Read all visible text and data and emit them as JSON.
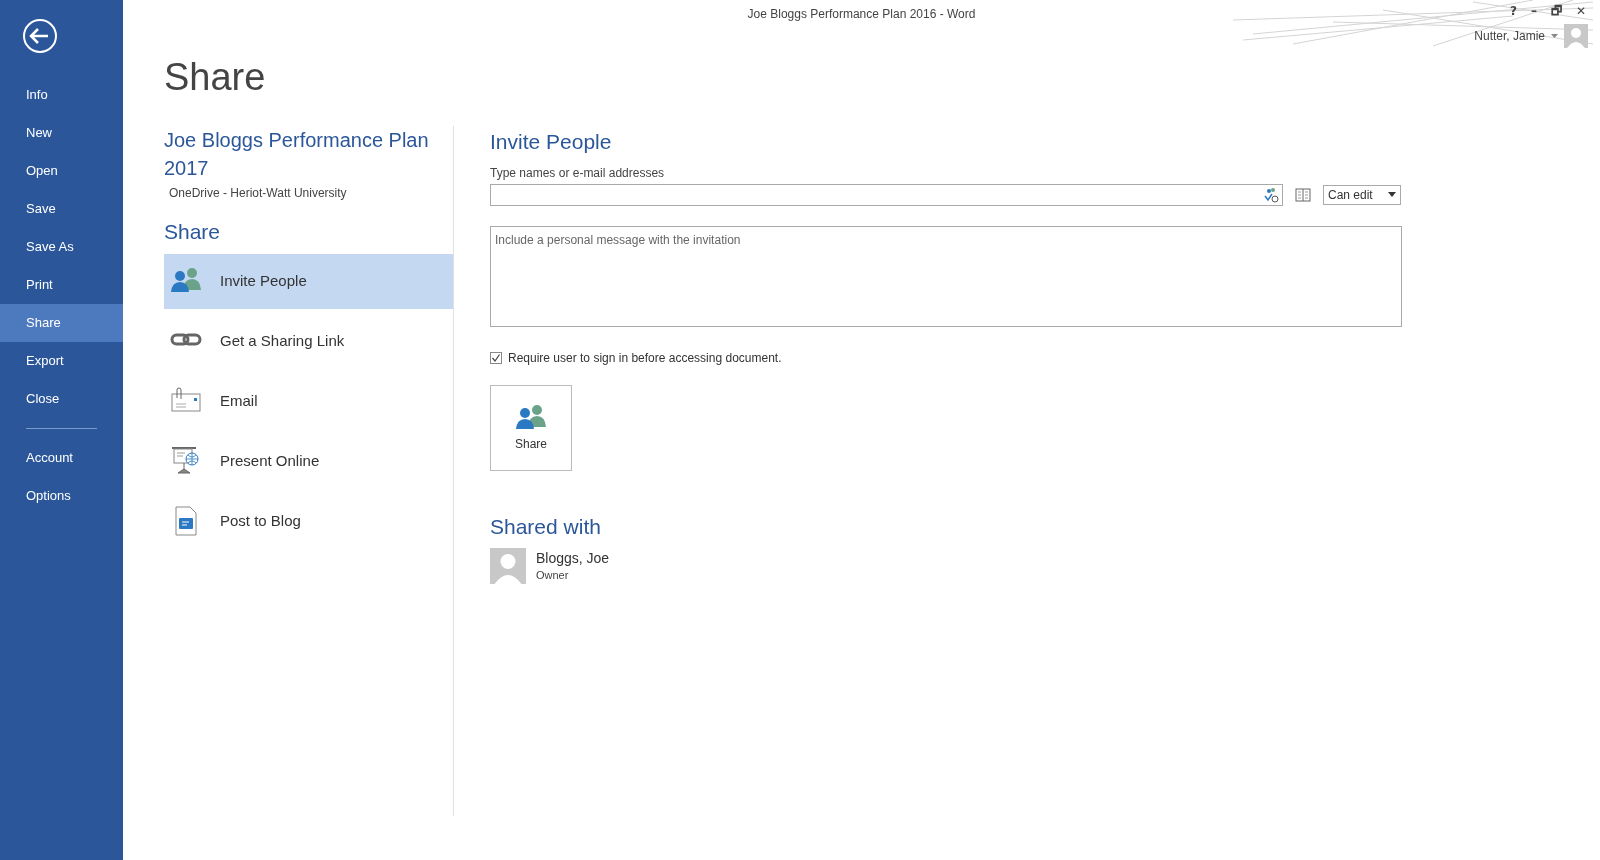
{
  "window": {
    "title": "Joe Bloggs Performance Plan 2016 - Word",
    "controls": [
      "?",
      "–",
      "🗗",
      "✕"
    ],
    "user": "Nutter, Jamie"
  },
  "nav": {
    "items": [
      {
        "label": "Info",
        "selected": false
      },
      {
        "label": "New",
        "selected": false
      },
      {
        "label": "Open",
        "selected": false
      },
      {
        "label": "Save",
        "selected": false
      },
      {
        "label": "Save As",
        "selected": false
      },
      {
        "label": "Print",
        "selected": false
      },
      {
        "label": "Share",
        "selected": true
      },
      {
        "label": "Export",
        "selected": false
      },
      {
        "label": "Close",
        "selected": false
      }
    ],
    "bottom_items": [
      {
        "label": "Account",
        "selected": false
      },
      {
        "label": "Options",
        "selected": false
      }
    ]
  },
  "page_title": "Share",
  "document": {
    "title": "Joe Bloggs Performance Plan 2017",
    "location": "OneDrive - Heriot-Watt University"
  },
  "share_heading": "Share",
  "share_options": [
    {
      "kind": "invite",
      "label": "Invite People",
      "selected": true
    },
    {
      "kind": "link",
      "label": "Get a Sharing Link",
      "selected": false
    },
    {
      "kind": "email",
      "label": "Email",
      "selected": false
    },
    {
      "kind": "present",
      "label": "Present Online",
      "selected": false
    },
    {
      "kind": "blog",
      "label": "Post to Blog",
      "selected": false
    }
  ],
  "invite": {
    "heading": "Invite People",
    "names_label": "Type names or e-mail addresses",
    "permission": "Can edit",
    "message_placeholder": "Include a personal message with the invitation",
    "require_sign_in": {
      "label": "Require user to sign in before accessing document.",
      "checked": true
    },
    "share_button": "Share"
  },
  "shared_with": {
    "heading": "Shared with",
    "people": [
      {
        "name": "Bloggs, Joe",
        "role": "Owner"
      }
    ]
  }
}
